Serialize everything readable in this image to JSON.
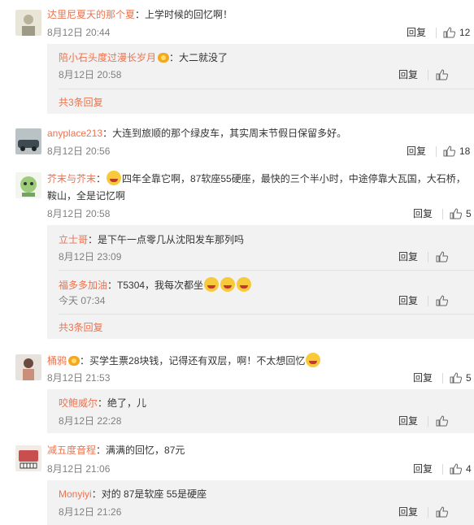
{
  "labels": {
    "reply": "回复",
    "colon": "："
  },
  "colors": {
    "username": "#eb7350",
    "sub_bg": "#f2f2f2",
    "time": "#808080"
  },
  "comments": [
    {
      "user": "达里尼夏天的那个夏",
      "text": "上学时候的回忆啊！",
      "time": "8月12日 20:44",
      "likes": "12",
      "replies": [
        {
          "user": "陪小石头度过漫长岁月",
          "text": "大二就没了",
          "time": "8月12日 20:58"
        }
      ],
      "more": "共3条回复"
    },
    {
      "user": "anyplace213",
      "text": "大连到旅顺的那个绿皮车，其实周末节假日保留多好。",
      "time": "8月12日 20:56",
      "likes": "18",
      "replies": []
    },
    {
      "user": "芥末与芥末",
      "text": "四年全靠它啊，87软座55硬座，最快的三个半小时，中途停靠大瓦国，大石桥，",
      "text_line2": "鞍山，全是记忆啊",
      "time": "8月12日 20:58",
      "likes": "5",
      "replies": [
        {
          "user": "立士哥",
          "text": "是下午一点零几从沈阳发车那列吗",
          "time": "8月12日 23:09"
        },
        {
          "user": "福多多加油",
          "text": "T5304，我每次都坐",
          "time": "今天 07:34"
        }
      ],
      "more": "共3条回复"
    },
    {
      "user": "桶鸦",
      "text": "买学生票28块钱，记得还有双层，啊！不太想回忆",
      "time": "8月12日 21:53",
      "likes": "5",
      "replies": [
        {
          "user": "咬鲍威尔",
          "text": "绝了，儿",
          "time": "8月12日 22:28"
        }
      ]
    },
    {
      "user": "减五度音程",
      "text": "满满的回忆，87元",
      "time": "8月12日 21:06",
      "likes": "4",
      "replies": [
        {
          "user": "Monyiyi",
          "text": "对的 87是软座 55是硬座",
          "time": "8月12日 21:26"
        }
      ]
    }
  ]
}
